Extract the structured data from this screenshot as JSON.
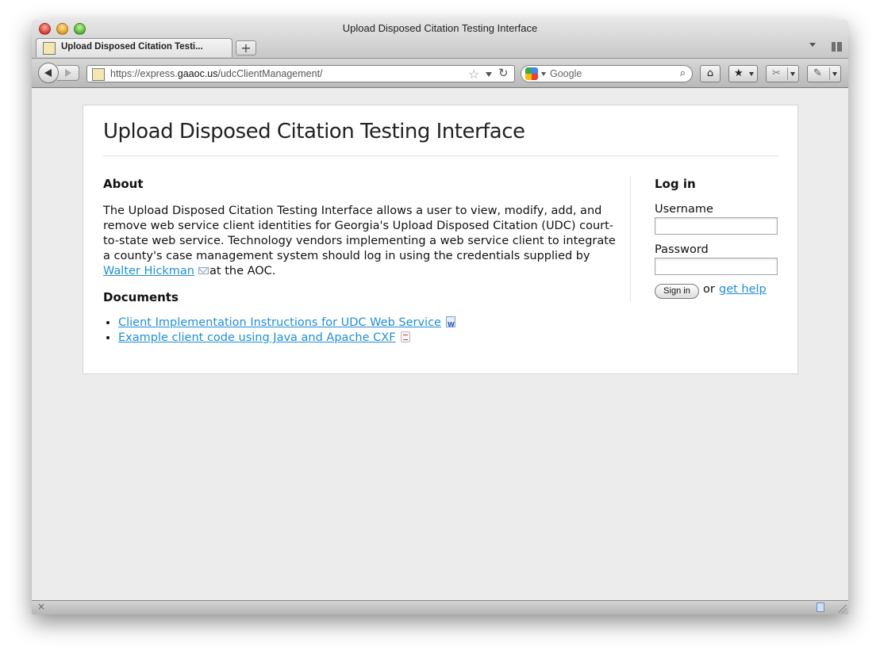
{
  "window": {
    "title": "Upload Disposed Citation Testing Interface"
  },
  "tabs": [
    {
      "label": "Upload Disposed Citation Testi..."
    }
  ],
  "newtab_label": "+",
  "toolbar": {
    "url_prefix": "https://express.",
    "url_domain": "gaaoc.us",
    "url_path": "/udcClientManagement/",
    "search_placeholder": "Google",
    "star_glyph": "☆",
    "reload_glyph": "↻",
    "search_glyph": "⌕",
    "home_glyph": "⌂",
    "bookmarks_glyph": "★",
    "addon_glyph": "✂",
    "tools_glyph": "✎"
  },
  "page": {
    "title": "Upload Disposed Citation Testing Interface",
    "about": {
      "heading": "About",
      "text_before": "The Upload Disposed Citation Testing Interface allows a user to view, modify, add, and remove web service client identities for Georgia's Upload Disposed Citation (UDC) court-to-state web service. Technology vendors implementing a web service client to integrate a county's case management system should log in using the credentials supplied by ",
      "contact_link": "Walter Hickman",
      "text_after": "at the AOC."
    },
    "documents": {
      "heading": "Documents",
      "items": [
        {
          "label": "Client Implementation Instructions for UDC Web Service",
          "icon": "word-doc-icon"
        },
        {
          "label": "Example client code using Java and Apache CXF",
          "icon": "pdf-doc-icon"
        }
      ]
    },
    "login": {
      "heading": "Log in",
      "username_label": "Username",
      "username_value": "",
      "password_label": "Password",
      "password_value": "",
      "signin_label": "Sign in",
      "or_text": "or",
      "help_link": "get help"
    }
  },
  "statusbar": {
    "close_glyph": "×"
  },
  "colors": {
    "link": "#1f8fd6",
    "content_bg": "#ececec",
    "panel_bg": "#ffffff"
  }
}
